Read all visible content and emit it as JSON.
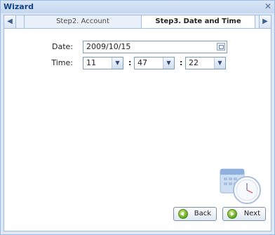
{
  "window": {
    "title": "Wizard",
    "close_glyph": "×"
  },
  "tabs": {
    "left_arrow": "◆",
    "right_arrow": "◆",
    "items": [
      {
        "label": "Step2. Account",
        "active": false
      },
      {
        "label": "Step3. Date and Time",
        "active": true
      }
    ]
  },
  "form": {
    "date_label": "Date:",
    "date_value": "2009/10/15",
    "time_label": "Time:",
    "hour": "11",
    "minute": "47",
    "second": "22",
    "separator": ":"
  },
  "buttons": {
    "back": "Back",
    "next": "Next"
  },
  "icons": {
    "close": "close-icon",
    "calendar": "calendar-icon",
    "dropdown": "chevron-down-icon",
    "back": "back-arrow-icon",
    "next": "next-arrow-icon",
    "illustration": "calendar-clock-icon"
  }
}
